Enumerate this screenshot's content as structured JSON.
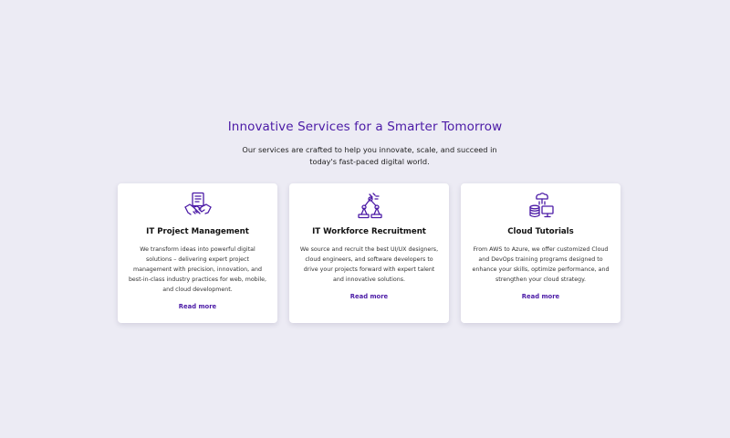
{
  "section": {
    "title": "Innovative Services for a Smarter Tomorrow",
    "subtitle": "Our services are crafted to help you innovate, scale, and succeed in today's fast-paced digital world."
  },
  "cards": [
    {
      "icon": "handshake-icon",
      "title": "IT Project Management",
      "description": "We transform ideas into powerful digital solutions – delivering expert project management with precision, innovation, and best-in-class industry practices for web, mobile, and cloud development.",
      "link": "Read more"
    },
    {
      "icon": "robot-arm-icon",
      "title": "IT Workforce Recruitment",
      "description": "We source and recruit the best UI/UX designers, cloud engineers, and software developers to drive your projects forward with expert talent and innovative solutions.",
      "link": "Read more"
    },
    {
      "icon": "cloud-network-icon",
      "title": "Cloud Tutorials",
      "description": "From AWS to Azure, we offer customized Cloud and DevOps training programs designed to enhance your skills, optimize performance, and strengthen your cloud strategy.",
      "link": "Read more"
    }
  ],
  "colors": {
    "background": "#ecebf4",
    "accent": "#4b1aa6",
    "card": "#ffffff"
  }
}
